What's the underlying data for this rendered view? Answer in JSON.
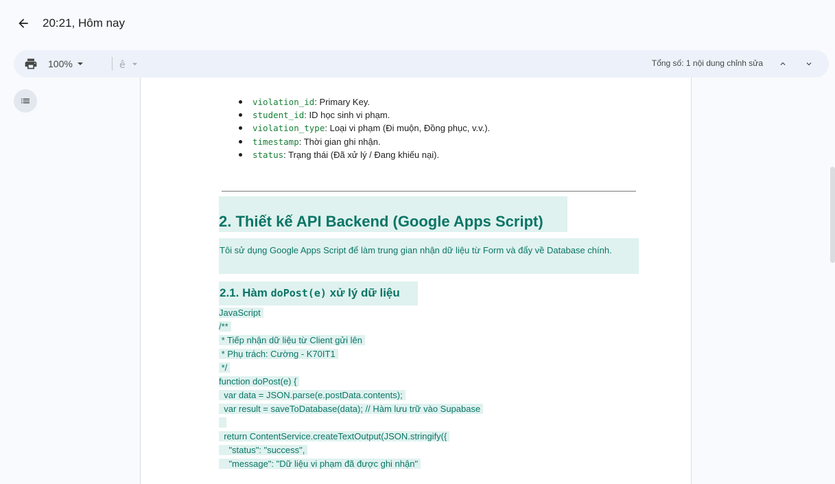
{
  "header": {
    "title": "20:21, Hôm nay"
  },
  "toolbar": {
    "zoom": "100%",
    "total_edits": "Tổng số: 1 nội dung chỉnh sửa"
  },
  "icons": {
    "back": "arrow-left-icon",
    "print": "print-icon",
    "zoom_dropdown": "caret-down-icon",
    "mode": "spelling-icon",
    "prev": "chevron-up-icon",
    "next": "chevron-down-icon",
    "outline": "list-icon"
  },
  "document": {
    "cutoff_heading": "...",
    "fields": [
      {
        "name": "violation_id",
        "desc": ": Primary Key."
      },
      {
        "name": "student_id",
        "desc": ": ID học sinh vi phạm."
      },
      {
        "name": "violation_type",
        "desc": ": Loại vi phạm (Đi muộn, Đồng phục, v.v.)."
      },
      {
        "name": "timestamp",
        "desc": ": Thời gian ghi nhận."
      },
      {
        "name": "status",
        "desc": ": Trạng thái (Đã xử lý / Đang khiếu nại)."
      }
    ],
    "section_heading": "2. Thiết kế API Backend (Google Apps Script)",
    "section_paragraph": "Tôi sử dụng Google Apps Script để làm trung gian nhận dữ liệu từ Form và đẩy về Database chính.",
    "subsection_prefix": "2.1. Hàm ",
    "subsection_code": "doPost(e)",
    "subsection_suffix": " xử lý dữ liệu",
    "code_lines": [
      "JavaScript",
      "/**",
      " * Tiếp nhận dữ liệu từ Client gửi lên",
      " * Phụ trách: Cường - K70IT1",
      " */",
      "function doPost(e) {",
      "  var data = JSON.parse(e.postData.contents);",
      "  var result = saveToDatabase(data); // Hàm lưu trữ vào Supabase",
      "  ",
      "  return ContentService.createTextOutput(JSON.stringify({",
      "    \"status\": \"success\",",
      "    \"message\": \"Dữ liệu vi phạm đã được ghi nhận\""
    ]
  },
  "colors": {
    "highlight": "#dff2ef",
    "accent_text": "#0b7566",
    "code_name": "#188038",
    "toolbar_bg": "#edf2fa",
    "page_bg": "#f8fafd"
  }
}
